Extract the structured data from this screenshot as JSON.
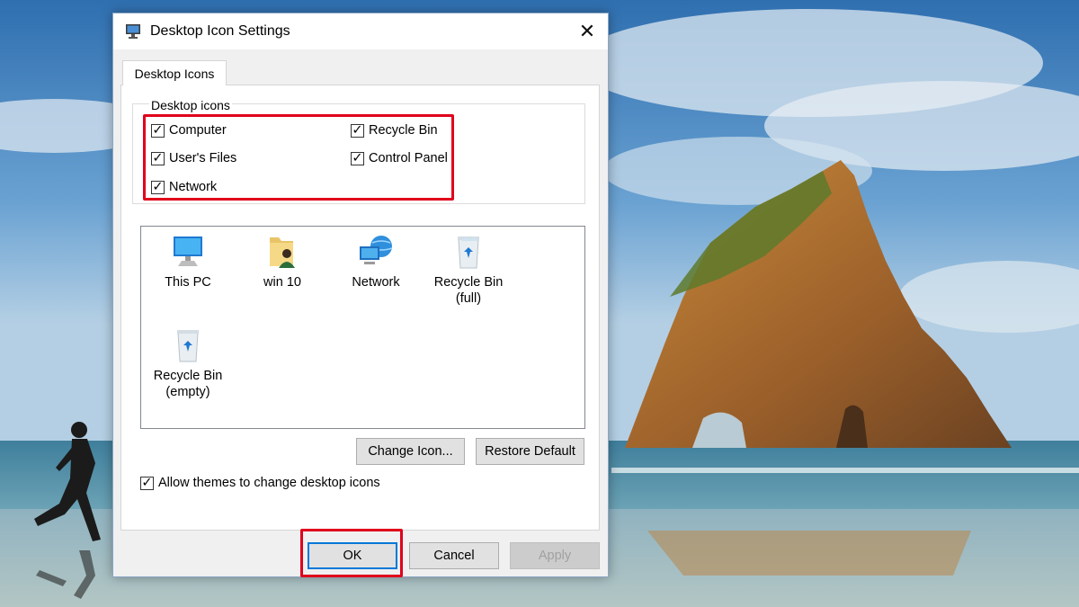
{
  "dialog": {
    "title": "Desktop Icon Settings",
    "close_glyph": "✕",
    "tab_label": "Desktop Icons",
    "group_title": "Desktop icons"
  },
  "checkboxes": [
    {
      "label": "Computer",
      "checked": true
    },
    {
      "label": "Recycle Bin",
      "checked": true
    },
    {
      "label": "User's Files",
      "checked": true
    },
    {
      "label": "Control Panel",
      "checked": true
    },
    {
      "label": "Network",
      "checked": true
    }
  ],
  "icons": [
    {
      "label": "This PC",
      "label2": "",
      "icon": "this-pc-icon"
    },
    {
      "label": "win 10",
      "label2": "",
      "icon": "user-folder-icon"
    },
    {
      "label": "Network",
      "label2": "",
      "icon": "network-icon"
    },
    {
      "label": "Recycle Bin",
      "label2": "(full)",
      "icon": "recycle-bin-full-icon"
    },
    {
      "label": "Recycle Bin",
      "label2": "(empty)",
      "icon": "recycle-bin-empty-icon"
    }
  ],
  "buttons": {
    "change_icon": "Change Icon...",
    "restore_default": "Restore Default",
    "ok": "OK",
    "cancel": "Cancel",
    "apply": "Apply"
  },
  "allow_themes": {
    "label": "Allow themes to change desktop icons",
    "checked": true
  },
  "colors": {
    "highlight": "#e0001b",
    "accent": "#0078d7"
  }
}
